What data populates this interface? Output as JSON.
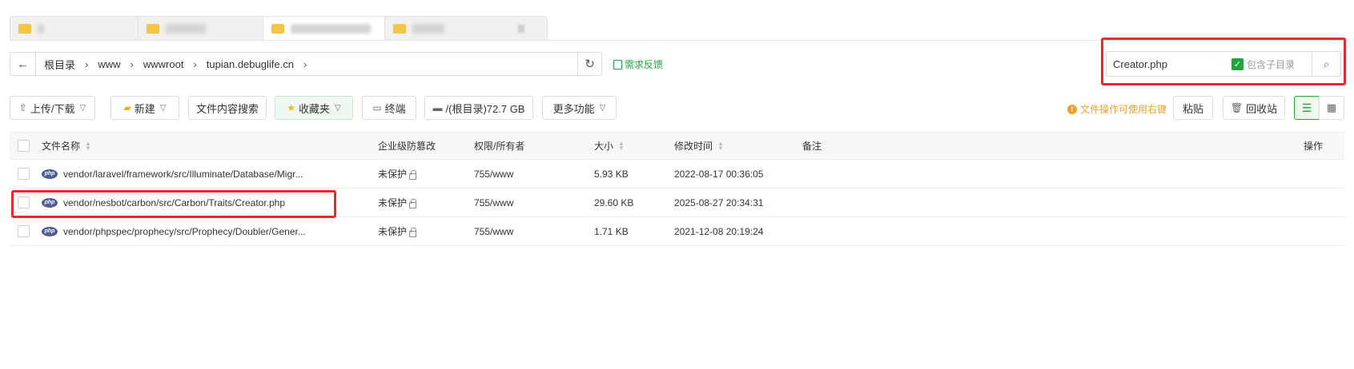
{
  "breadcrumb": {
    "items": [
      "根目录",
      "www",
      "wwwroot",
      "tupian.debuglife.cn"
    ]
  },
  "feedback_label": "需求反馈",
  "search": {
    "value": "Creator.php",
    "subdir_label": "包含子目录"
  },
  "toolbar": {
    "upload_label": "上传/下载",
    "new_label": "新建",
    "content_search_label": "文件内容搜索",
    "favorites_label": "收藏夹",
    "terminal_label": "终端",
    "disk_label": "/(根目录)72.7 GB",
    "more_label": "更多功能",
    "tip_label": "文件操作可使用右键",
    "paste_label": "粘贴",
    "recycle_label": "回收站"
  },
  "table": {
    "headers": {
      "name": "文件名称",
      "protect": "企业级防篡改",
      "perm": "权限/所有者",
      "size": "大小",
      "mtime": "修改时间",
      "note": "备注",
      "ops": "操作"
    },
    "rows": [
      {
        "name": "vendor/laravel/framework/src/Illuminate/Database/Migr...",
        "protect": "未保护",
        "perm": "755/www",
        "size": "5.93 KB",
        "mtime": "2022-08-17 00:36:05"
      },
      {
        "name": "vendor/nesbot/carbon/src/Carbon/Traits/Creator.php",
        "protect": "未保护",
        "perm": "755/www",
        "size": "29.60 KB",
        "mtime": "2025-08-27 20:34:31"
      },
      {
        "name": "vendor/phpspec/prophecy/src/Prophecy/Doubler/Gener...",
        "protect": "未保护",
        "perm": "755/www",
        "size": "1.71 KB",
        "mtime": "2021-12-08 20:19:24"
      }
    ]
  },
  "colors": {
    "accent": "#20a53a",
    "highlight": "#e8282a",
    "tip": "#f0a020"
  }
}
